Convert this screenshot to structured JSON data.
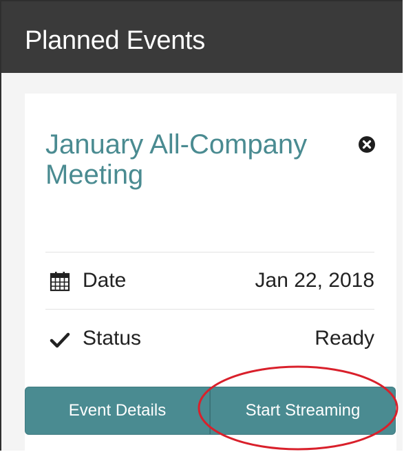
{
  "header": {
    "title": "Planned Events"
  },
  "event": {
    "title": "January All-Company Meeting",
    "close_icon": "close-circle-icon",
    "rows": [
      {
        "icon": "calendar-icon",
        "label": "Date",
        "value": "Jan 22, 2018"
      },
      {
        "icon": "checkmark-icon",
        "label": "Status",
        "value": "Ready"
      }
    ],
    "buttons": {
      "details_label": "Event Details",
      "stream_label": "Start Streaming"
    }
  },
  "colors": {
    "header_bg": "#3a3a3a",
    "accent": "#4a8b91",
    "annotation": "#d9202b"
  }
}
